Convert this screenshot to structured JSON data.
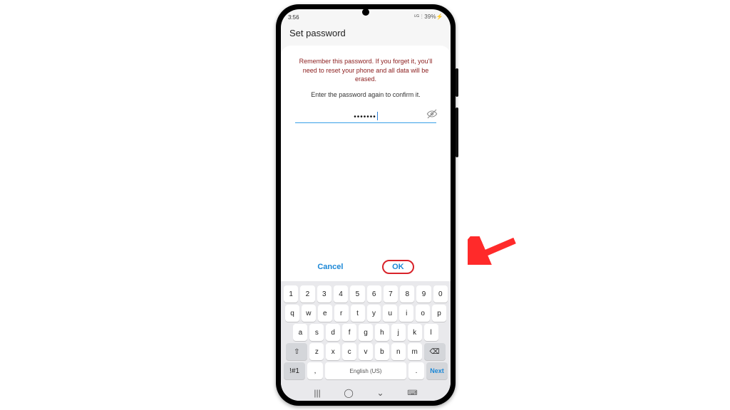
{
  "status": {
    "time": "3:56",
    "dots": "∵",
    "battery": "⁵ᴳ ⫶ 39%⚡"
  },
  "title": "Set password",
  "warning": "Remember this password. If you forget it, you'll need to reset your phone and all data will be erased.",
  "prompt": "Enter the password again to confirm it.",
  "password_mask": "•••••••",
  "buttons": {
    "cancel": "Cancel",
    "ok": "OK"
  },
  "keyboard": {
    "row1": [
      "1",
      "2",
      "3",
      "4",
      "5",
      "6",
      "7",
      "8",
      "9",
      "0"
    ],
    "row2": [
      "q",
      "w",
      "e",
      "r",
      "t",
      "y",
      "u",
      "i",
      "o",
      "p"
    ],
    "row3": [
      "a",
      "s",
      "d",
      "f",
      "g",
      "h",
      "j",
      "k",
      "l"
    ],
    "row4_shift": "⇧",
    "row4": [
      "z",
      "x",
      "c",
      "v",
      "b",
      "n",
      "m"
    ],
    "row4_bksp": "⌫",
    "sym": "!#1",
    "comma": ",",
    "space": "English (US)",
    "period": ".",
    "next": "Next"
  },
  "nav": {
    "recent": "|||",
    "home": "◯",
    "back": "⌄",
    "kbd": "⌨"
  }
}
